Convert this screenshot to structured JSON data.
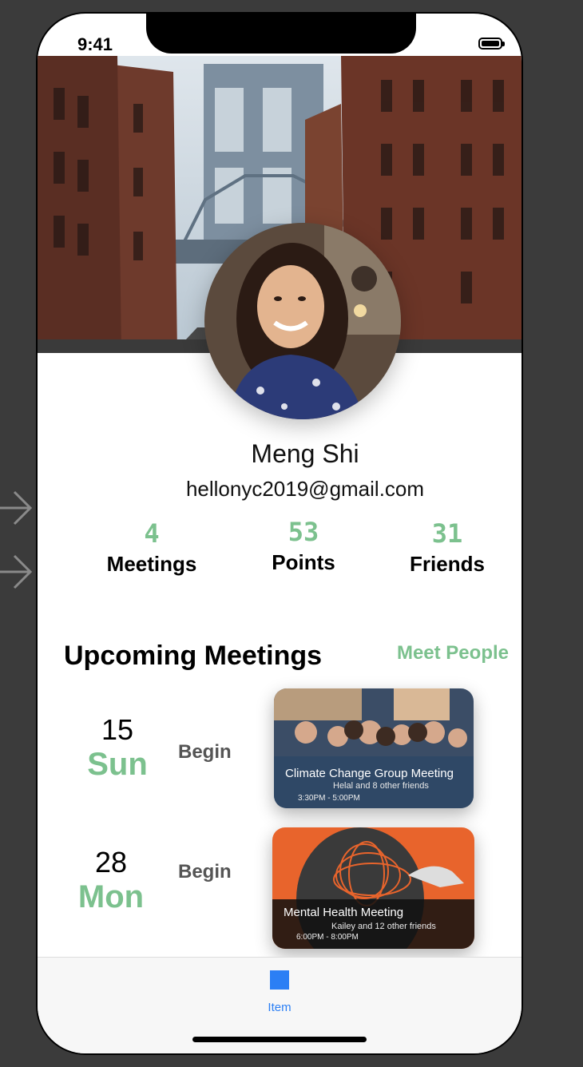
{
  "status_bar": {
    "time": "9:41"
  },
  "profile": {
    "name": "Meng Shi",
    "email": "hellonyc2019@gmail.com"
  },
  "stats": [
    {
      "value": "4",
      "label": "Meetings"
    },
    {
      "value": "53",
      "label": "Points"
    },
    {
      "value": "31",
      "label": "Friends"
    }
  ],
  "section": {
    "title": "Upcoming Meetings",
    "link": "Meet People"
  },
  "meetings": [
    {
      "day": "15",
      "weekday": "Sun",
      "action": "Begin",
      "title": "Climate Change Group Meeting",
      "friends": "Helal and 8 other friends",
      "time": "3:30PM - 5:00PM"
    },
    {
      "day": "28",
      "weekday": "Mon",
      "action": "Begin",
      "title": "Mental Health Meeting",
      "friends": "Kailey and 12 other friends",
      "time": "6:00PM - 8:00PM"
    }
  ],
  "tabbar": {
    "item_label": "Item"
  },
  "colors": {
    "accent_green": "#7cc18e",
    "tab_blue": "#2b7ff5"
  }
}
